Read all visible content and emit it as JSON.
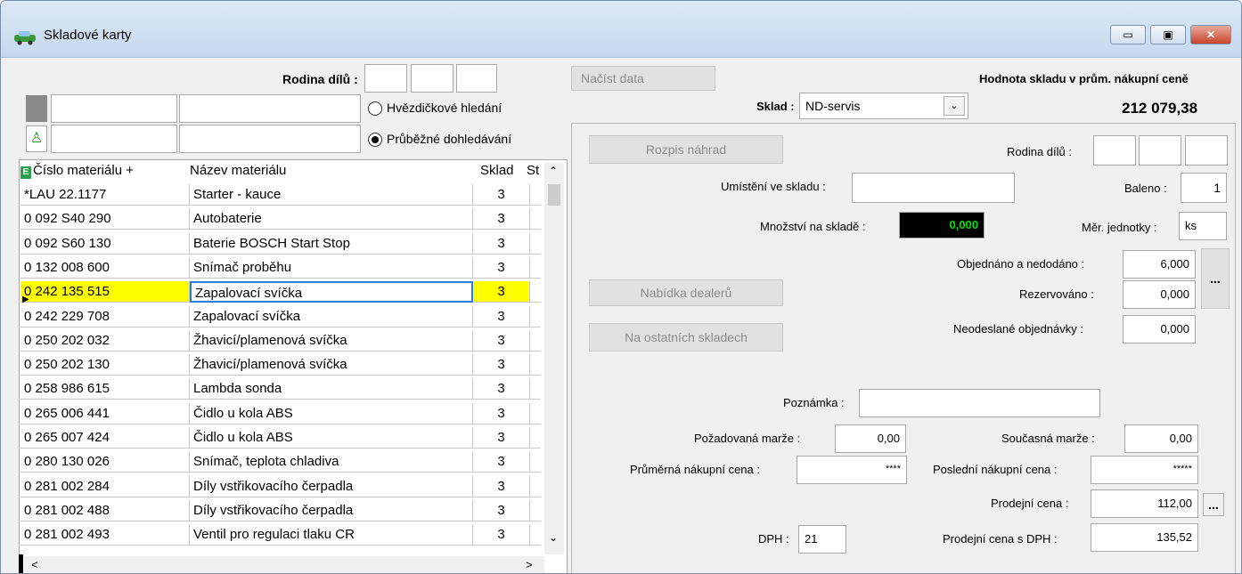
{
  "window": {
    "title": "Skladové karty",
    "buttons": {
      "minimize": "▭",
      "maximize": "▣",
      "close": "✕"
    }
  },
  "filter": {
    "rodina_label": "Rodina dílů :",
    "hvezdickove": "Hvězdičkové hledání",
    "prubezne": "Průběžné dohledávání"
  },
  "grid": {
    "headers": {
      "marker": "E",
      "cislo": "Číslo materiálu +",
      "nazev": "Název materiálu",
      "sklad": "Sklad",
      "st": "St"
    },
    "rows": [
      {
        "cislo": "*LAU 22.1177",
        "nazev": "Starter - kauce",
        "sklad": "3"
      },
      {
        "cislo": "0 092 S40 290",
        "nazev": "Autobaterie",
        "sklad": "3"
      },
      {
        "cislo": "0 092 S60 130",
        "nazev": "Baterie BOSCH Start Stop",
        "sklad": "3"
      },
      {
        "cislo": "0 132 008 600",
        "nazev": "Snímač proběhu",
        "sklad": "3"
      },
      {
        "cislo": "0 242 135 515",
        "nazev": "Zapalovací svíčka",
        "sklad": "3",
        "selected": true
      },
      {
        "cislo": "0 242 229 708",
        "nazev": "Zapalovací svíčka",
        "sklad": "3"
      },
      {
        "cislo": "0 250 202 032",
        "nazev": "Žhavicí/plamenová svíčka",
        "sklad": "3"
      },
      {
        "cislo": "0 250 202 130",
        "nazev": "Žhavicí/plamenová svíčka",
        "sklad": "3"
      },
      {
        "cislo": "0 258 986 615",
        "nazev": "Lambda sonda",
        "sklad": "3"
      },
      {
        "cislo": "0 265 006 441",
        "nazev": "Čidlo u kola ABS",
        "sklad": "3"
      },
      {
        "cislo": "0 265 007 424",
        "nazev": "Čidlo u kola ABS",
        "sklad": "3"
      },
      {
        "cislo": "0 280 130 026",
        "nazev": "Snímač, teplota chladiva",
        "sklad": "3"
      },
      {
        "cislo": "0 281 002 284",
        "nazev": "Díly vstřikovacího čerpadla",
        "sklad": "3"
      },
      {
        "cislo": "0 281 002 488",
        "nazev": "Díly vstřikovacího čerpadla",
        "sklad": "3"
      },
      {
        "cislo": "0 281 002 493",
        "nazev": "Ventil pro regulaci tlaku CR",
        "sklad": "3"
      }
    ],
    "selected_color": "#ffff00",
    "scroll": {
      "up": "⌃",
      "down": "⌄",
      "left": "<",
      "right": ">"
    }
  },
  "top": {
    "nacist": "Načíst data",
    "hodnota_label": "Hodnota skladu v prům. nákupní ceně",
    "hodnota": "212 079,38",
    "sklad_label": "Sklad :",
    "sklad_value": "ND-servis"
  },
  "detail": {
    "rozpis": "Rozpis náhrad",
    "nabidka": "Nabídka dealerů",
    "ostatni": "Na ostatních skladech",
    "rodina_label": "Rodina dílů :",
    "umisteni_label": "Umístění ve skladu :",
    "umisteni": "",
    "baleno_label": "Baleno :",
    "baleno": "1",
    "mnozstvi_label": "Množství na skladě :",
    "mnozstvi": "0,000",
    "merne_label": "Měr. jednotky :",
    "merne": "ks",
    "objednano_label": "Objednáno a nedodáno :",
    "objednano": "6,000",
    "rezervovano_label": "Rezervováno :",
    "rezervovano": "0,000",
    "neodeslane_label": "Neodeslané objednávky :",
    "neodeslane": "0,000",
    "more": "...",
    "poznamka_label": "Poznámka :",
    "poznamka": "",
    "pozadovana_label": "Požadovaná marže :",
    "pozadovana": "0,00",
    "soucasna_label": "Současná marže :",
    "soucasna": "0,00",
    "prumerna_label": "Průměrná nákupní cena :",
    "prumerna": "****",
    "posledni_label": "Poslední nákupní cena :",
    "posledni": "*****",
    "prodejni_label": "Prodejní cena :",
    "prodejni": "112,00",
    "dph_label": "DPH :",
    "dph": "21",
    "sdph_label": "Prodejní cena  s DPH :",
    "sdph": "135,52"
  }
}
